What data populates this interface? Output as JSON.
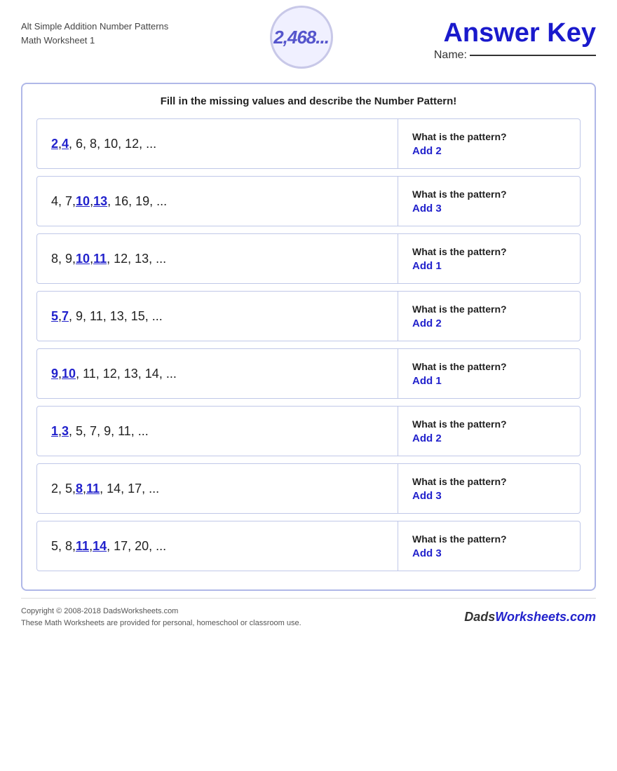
{
  "header": {
    "title_line1": "Alt Simple Addition Number Patterns",
    "title_line2": "Math Worksheet 1",
    "logo_text": "2,468...",
    "name_label": "Name:",
    "answer_key_label": "Answer Key"
  },
  "instruction": "Fill in the missing values and describe the Number Pattern!",
  "problems": [
    {
      "id": 1,
      "sequence_parts": [
        {
          "text": "2",
          "type": "answer"
        },
        {
          "text": " ,  ",
          "type": "normal"
        },
        {
          "text": "4",
          "type": "answer"
        },
        {
          "text": " ,  6,  8,  10,  12,  ...",
          "type": "normal"
        }
      ],
      "pattern_question": "What is the pattern?",
      "pattern_answer": "Add 2"
    },
    {
      "id": 2,
      "sequence_parts": [
        {
          "text": "4,  7,  ",
          "type": "normal"
        },
        {
          "text": "10",
          "type": "answer"
        },
        {
          "text": " ,  ",
          "type": "normal"
        },
        {
          "text": "13",
          "type": "answer"
        },
        {
          "text": " ,  16,  19,  ...",
          "type": "normal"
        }
      ],
      "pattern_question": "What is the pattern?",
      "pattern_answer": "Add 3"
    },
    {
      "id": 3,
      "sequence_parts": [
        {
          "text": "8,  9,  ",
          "type": "normal"
        },
        {
          "text": "10",
          "type": "answer"
        },
        {
          "text": " ,  ",
          "type": "normal"
        },
        {
          "text": "11",
          "type": "answer"
        },
        {
          "text": " ,  12,  13,  ...",
          "type": "normal"
        }
      ],
      "pattern_question": "What is the pattern?",
      "pattern_answer": "Add 1"
    },
    {
      "id": 4,
      "sequence_parts": [
        {
          "text": "5",
          "type": "answer"
        },
        {
          "text": " ,  ",
          "type": "normal"
        },
        {
          "text": "7",
          "type": "answer"
        },
        {
          "text": " ,  9,  11,  13,  15,  ...",
          "type": "normal"
        }
      ],
      "pattern_question": "What is the pattern?",
      "pattern_answer": "Add 2"
    },
    {
      "id": 5,
      "sequence_parts": [
        {
          "text": "9",
          "type": "answer"
        },
        {
          "text": " ,  ",
          "type": "normal"
        },
        {
          "text": "10",
          "type": "answer"
        },
        {
          "text": " ,  11,  12,  13,  14,  ...",
          "type": "normal"
        }
      ],
      "pattern_question": "What is the pattern?",
      "pattern_answer": "Add 1"
    },
    {
      "id": 6,
      "sequence_parts": [
        {
          "text": "1",
          "type": "answer"
        },
        {
          "text": " ,  ",
          "type": "normal"
        },
        {
          "text": "3",
          "type": "answer"
        },
        {
          "text": " ,  5,  7,  9,  11,  ...",
          "type": "normal"
        }
      ],
      "pattern_question": "What is the pattern?",
      "pattern_answer": "Add 2"
    },
    {
      "id": 7,
      "sequence_parts": [
        {
          "text": "2,  5,  ",
          "type": "normal"
        },
        {
          "text": "8",
          "type": "answer"
        },
        {
          "text": " ,  ",
          "type": "normal"
        },
        {
          "text": "11",
          "type": "answer"
        },
        {
          "text": " ,  14,  17,  ...",
          "type": "normal"
        }
      ],
      "pattern_question": "What is the pattern?",
      "pattern_answer": "Add 3"
    },
    {
      "id": 8,
      "sequence_parts": [
        {
          "text": "5,  8,  ",
          "type": "normal"
        },
        {
          "text": "11",
          "type": "answer"
        },
        {
          "text": " ,  ",
          "type": "normal"
        },
        {
          "text": "14",
          "type": "answer"
        },
        {
          "text": " ,  17,  20,  ...",
          "type": "normal"
        }
      ],
      "pattern_question": "What is the pattern?",
      "pattern_answer": "Add 3"
    }
  ],
  "footer": {
    "copyright": "Copyright © 2008-2018 DadsWorksheets.com",
    "note": "These Math Worksheets are provided for personal, homeschool or classroom use.",
    "brand": "DadsWorksheets.com"
  }
}
